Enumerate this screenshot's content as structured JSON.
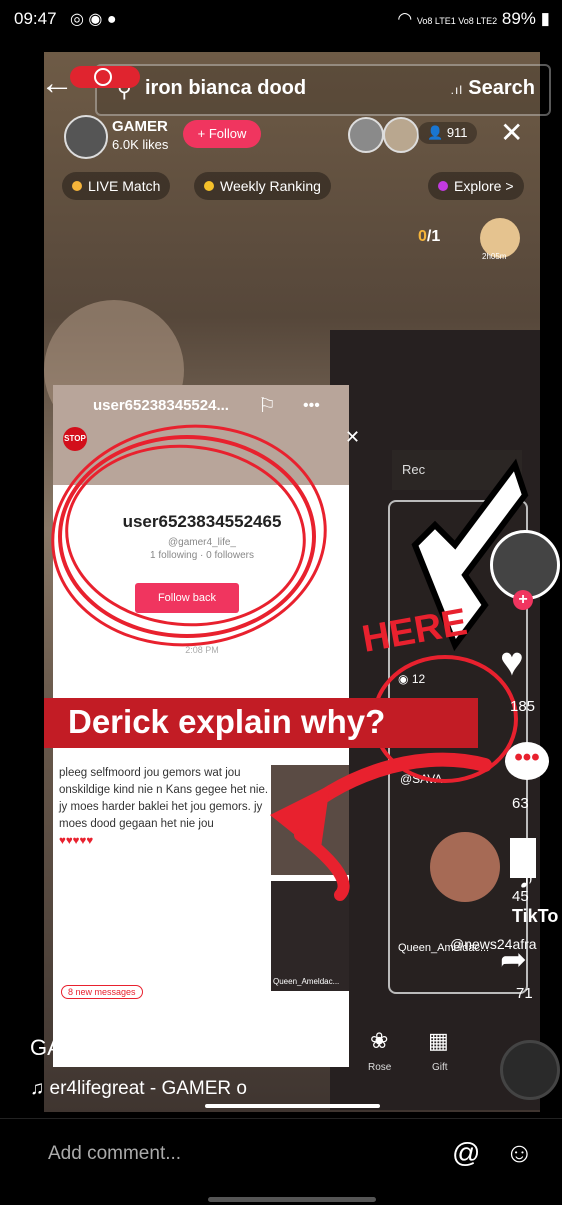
{
  "status": {
    "time": "09:47",
    "battery": "89%",
    "signal": "Vo8 LTE1 Vo8 LTE2"
  },
  "search": {
    "query": "iron bianca dood",
    "button": "Search"
  },
  "host": {
    "name": "GAMER",
    "likes": "6.0K likes",
    "follow": "+ Follow",
    "viewers": "911"
  },
  "chips": {
    "live_match": "LIVE Match",
    "weekly_ranking": "Weekly Ranking",
    "explore": "Explore >"
  },
  "goal": {
    "current": "0",
    "total": "/1",
    "timer": "2h05m"
  },
  "inset": {
    "title_user": "user65238345524...",
    "profile_username": "user6523834552465",
    "profile_handle": "@gamer4_life_",
    "profile_stats": "1 following · 0 followers",
    "follow_back": "Follow back",
    "card_time": "2:08 PM",
    "chat_text": "pleeg selfmoord jou gemors wat jou onskildige kind nie n Kans gegee het nie. jy moes harder baklei het jou gemors. jy moes dood gegaan het nie jou",
    "hearts": "♥♥♥♥♥",
    "new_messages": "8 new messages",
    "thumb_label": "Queen_Ameldac..."
  },
  "caption": "Derick explain why?",
  "annotation_word": "HERE",
  "right_panel": {
    "recent": "Rec",
    "user_label": "@SAVA",
    "viewer_count": "12",
    "bottom_label": "Queen_Ameldac..."
  },
  "actions": {
    "likes": "185",
    "comments": "63",
    "shares": "71",
    "bookmarks": "45"
  },
  "tiktok_watermark": {
    "brand": "TikTo",
    "handle": "@news24afra"
  },
  "bottom": {
    "creator": "GAMER",
    "song": "er4lifegreat - GAMER   o",
    "rose": "Rose",
    "gift": "Gift"
  },
  "comment": {
    "placeholder": "Add comment..."
  }
}
